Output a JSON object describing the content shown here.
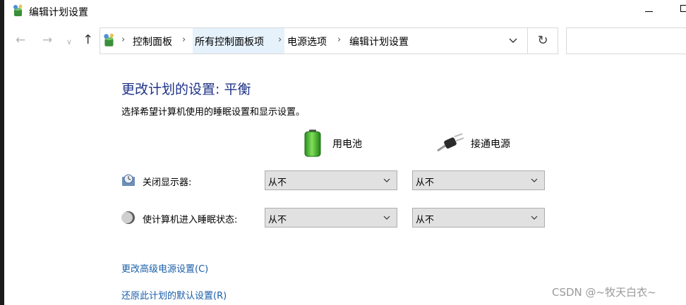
{
  "window": {
    "title": "编辑计划设置"
  },
  "nav": {
    "back_icon": "arrow-left-icon",
    "forward_icon": "arrow-right-icon",
    "recent_icon": "chevron-down-icon",
    "up_icon": "arrow-up-icon"
  },
  "address": {
    "icon": "control-panel-icon",
    "crumbs": [
      "控制面板",
      "所有控制面板项",
      "电源选项",
      "编辑计划设置"
    ]
  },
  "search": {
    "placeholder": ""
  },
  "main": {
    "heading": "更改计划的设置: 平衡",
    "subtitle": "选择希望计算机使用的睡眠设置和显示设置。",
    "columns": {
      "battery": "用电池",
      "plugged": "接通电源"
    },
    "rows": [
      {
        "label": "关闭显示器:",
        "battery_value": "从不",
        "plugged_value": "从不"
      },
      {
        "label": "使计算机进入睡眠状态:",
        "battery_value": "从不",
        "plugged_value": "从不"
      }
    ],
    "links": {
      "advanced": "更改高级电源设置(C)",
      "restore": "还原此计划的默认设置(R)"
    }
  },
  "watermark": "CSDN @~牧天白衣~",
  "colors": {
    "heading": "#1e3287",
    "link": "#1a5ea8",
    "crumb_highlight": "#e5f1fb"
  }
}
